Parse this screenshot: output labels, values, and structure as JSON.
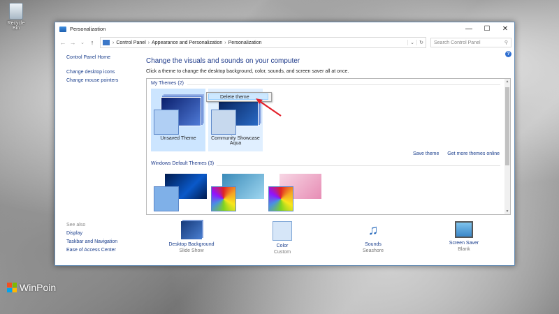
{
  "desktop": {
    "recycle_bin": "Recycle Bin"
  },
  "window": {
    "title": "Personalization",
    "minimize": "—",
    "maximize": "☐",
    "close": "✕"
  },
  "nav": {
    "back": "←",
    "forward": "→",
    "up": "↑",
    "breadcrumb": [
      "Control Panel",
      "Appearance and Personalization",
      "Personalization"
    ],
    "search_placeholder": "Search Control Panel"
  },
  "sidebar": {
    "home": "Control Panel Home",
    "links": [
      "Change desktop icons",
      "Change mouse pointers"
    ],
    "see_also_header": "See also",
    "see_also": [
      "Display",
      "Taskbar and Navigation",
      "Ease of Access Center"
    ]
  },
  "main": {
    "heading": "Change the visuals and sounds on your computer",
    "description": "Click a theme to change the desktop background, color, sounds, and screen saver all at once."
  },
  "themes": {
    "my_themes_label": "My Themes (2)",
    "my_themes": [
      "Unsaved Theme",
      "Community Showcase Aqua"
    ],
    "save_theme": "Save theme",
    "get_more": "Get more themes online",
    "default_label": "Windows Default Themes (3)"
  },
  "context_menu": {
    "items": [
      "Delete theme"
    ]
  },
  "bottom": [
    {
      "label": "Desktop Background",
      "value": "Slide Show"
    },
    {
      "label": "Color",
      "value": "Custom"
    },
    {
      "label": "Sounds",
      "value": "Seashore"
    },
    {
      "label": "Screen Saver",
      "value": "Blank"
    }
  ],
  "watermark": "WinPoin",
  "colors": {
    "accent": "#1e3a8a",
    "selection": "#cce5ff",
    "link": "#1a3e8c"
  }
}
